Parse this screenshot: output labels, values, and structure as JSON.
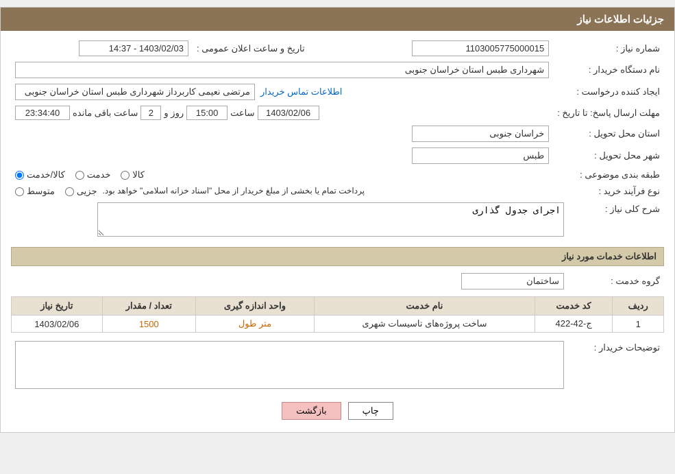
{
  "header": {
    "title": "جزئیات اطلاعات نیاز"
  },
  "fields": {
    "shomara_niaz_label": "شماره نیاز :",
    "shomara_niaz_value": "1103005775000015",
    "nam_dastgah_label": "نام دستگاه خریدار :",
    "nam_dastgah_value": "شهرداری طبس استان خراسان جنوبی",
    "ijad_konande_label": "ایجاد کننده درخواست :",
    "ijad_konande_value": "مرتضی نعیمی کاربرداز شهرداری طبس استان خراسان جنوبی",
    "etelaat_link": "اطلاعات تماس خریدار",
    "mohlat_label": "مهلت ارسال پاسخ: تا تاریخ :",
    "date_value": "1403/02/06",
    "saat_label": "ساعت",
    "saat_value": "15:00",
    "rooz_label": "روز و",
    "rooz_value": "2",
    "baqi_label": "ساعت باقی مانده",
    "baqi_value": "23:34:40",
    "tarikh_ilan_label": "تاریخ و ساعت اعلان عمومی :",
    "tarikh_ilan_value": "1403/02/03 - 14:37",
    "ostan_tahvil_label": "استان محل تحویل :",
    "ostan_tahvil_value": "خراسان جنوبی",
    "shahr_tahvil_label": "شهر محل تحویل :",
    "shahr_tahvil_value": "طبس",
    "tabaqe_label": "طبقه بندی موضوعی :",
    "kala_label": "کالا",
    "khedmat_label": "خدمت",
    "kala_khedmat_label": "کالا/خدمت",
    "radio_kala_checked": false,
    "radio_khedmat_checked": false,
    "radio_kala_khedmat_checked": true,
    "nooe_farayand_label": "نوع فرآیند خرید :",
    "jozyi_label": "جزیی",
    "motavasset_label": "متوسط",
    "farayand_warning": "پرداخت تمام یا بخشی از مبلغ خریدار از محل \"اسناد خزانه اسلامی\" خواهد بود.",
    "sharh_label": "شرح کلی نیاز :",
    "sharh_value": "اجرای جدول گذاری",
    "khadamat_section": "اطلاعات خدمات مورد نیاز",
    "gorohe_khadamat_label": "گروه خدمت :",
    "gorohe_khadamat_value": "ساختمان",
    "table": {
      "headers": [
        "ردیف",
        "کد خدمت",
        "نام خدمت",
        "واحد اندازه گیری",
        "تعداد / مقدار",
        "تاریخ نیاز"
      ],
      "rows": [
        {
          "radif": "1",
          "kod_khedmat": "ج-42-422",
          "nam_khedmat": "ساخت پروژه‌های تاسیسات شهری",
          "vahed": "متر طول",
          "tedad": "1500",
          "tarikh": "1403/02/06"
        }
      ]
    },
    "tosif_label": "توضیحات خریدار :",
    "tosif_value": "",
    "btn_print": "چاپ",
    "btn_back": "بازگشت"
  }
}
